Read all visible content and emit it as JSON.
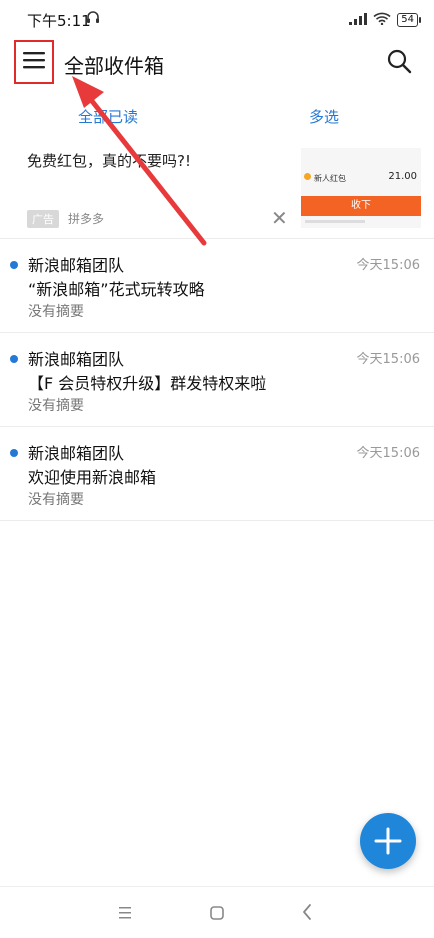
{
  "status_bar": {
    "time": "下午5:11",
    "battery": "54"
  },
  "header": {
    "title": "全部收件箱"
  },
  "actions": {
    "mark_all_read": "全部已读",
    "multi_select": "多选"
  },
  "ad": {
    "text": "免费红包，真的不要吗?!",
    "badge": "广告",
    "source": "拼多多",
    "thumbnail": {
      "label": "新人红包",
      "amount": "21.00",
      "button": "收下"
    }
  },
  "mails": [
    {
      "sender": "新浪邮箱团队",
      "time": "今天15:06",
      "subject": "“新浪邮箱”花式玩转攻略",
      "summary": "没有摘要"
    },
    {
      "sender": "新浪邮箱团队",
      "time": "今天15:06",
      "subject": "【F 会员特权升级】群发特权来啦",
      "summary": "没有摘要"
    },
    {
      "sender": "新浪邮箱团队",
      "time": "今天15:06",
      "subject": "欢迎使用新浪邮箱",
      "summary": "没有摘要"
    }
  ],
  "colors": {
    "accent": "#2479d6",
    "fab": "#1f86d9",
    "highlight": "#e02b2b",
    "ad_button": "#f26324"
  },
  "icons": {
    "menu": "hamburger-menu-icon",
    "search": "search-icon",
    "close": "close-icon",
    "compose": "plus-icon"
  }
}
